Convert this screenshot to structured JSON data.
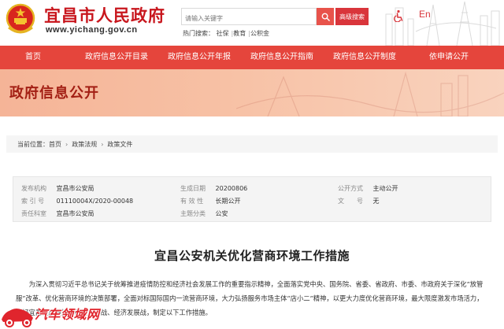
{
  "header": {
    "site_title": "宜昌市人民政府",
    "site_url": "www.yichang.gov.cn",
    "search_placeholder": "请输入关键字",
    "advanced_search_label": "高级搜索",
    "hot_search_label": "热门搜索：",
    "hot_search_terms": [
      "社保",
      "教育",
      "公积金"
    ],
    "lang_label": "En",
    "brand_color": "#c8161d"
  },
  "nav": {
    "items": [
      "首页",
      "政府信息公开目录",
      "政府信息公开年报",
      "政府信息公开指南",
      "政府信息公开制度",
      "依申请公开"
    ],
    "bg_color": "#e5453c"
  },
  "banner": {
    "title": "政府信息公开"
  },
  "breadcrumb": {
    "prefix": "当前位置：",
    "items": [
      "首页",
      "政策法规",
      "政策文件"
    ]
  },
  "info": {
    "publisher_label": "发布机构",
    "publisher": "宜昌市公安局",
    "index_label": "索 引 号",
    "index": "01110004X/2020-00048",
    "responsible_label": "责任科室",
    "responsible": "宜昌市公安局",
    "created_label": "生成日期",
    "created": "20200806",
    "validity_label": "有 效 性",
    "validity": "长期公开",
    "category_label": "主题分类",
    "category": "公安",
    "disclosure_label": "公开方式",
    "disclosure": "主动公开",
    "doc_no_label": "文　　号",
    "doc_no": "无"
  },
  "article": {
    "title": "宜昌公安机关优化营商环境工作措施",
    "body": "为深入贯彻习近平总书记关于统筹推进疫情防控和经济社会发展工作的重要指示精神，全面落实党中央、国务院、省委、省政府、市委、市政府关于深化“放管服”改革、优化营商环境的决策部署，全面对标国际国内一流营商环境，大力弘扬服务市场主体“店小二”精神，以更大力度优化营商环境，最大限度激发市场活力，打好宜昌疫后重振的民生保卫战、经济发展战，制定以下工作措施。"
  },
  "watermark": {
    "text": "汽车领域网"
  }
}
